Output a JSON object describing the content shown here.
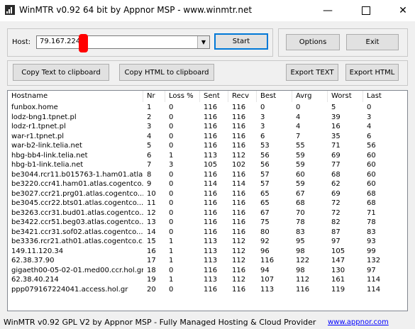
{
  "window": {
    "title": "WinMTR v0.92 64 bit by Appnor MSP - www.winmtr.net"
  },
  "host": {
    "label": "Host:",
    "value": "79.167.224."
  },
  "buttons": {
    "start": "Start",
    "options": "Options",
    "exit": "Exit",
    "copy_text": "Copy Text to clipboard",
    "copy_html": "Copy HTML to clipboard",
    "export_text": "Export TEXT",
    "export_html": "Export HTML"
  },
  "table": {
    "columns": [
      "Hostname",
      "Nr",
      "Loss %",
      "Sent",
      "Recv",
      "Best",
      "Avrg",
      "Worst",
      "Last"
    ],
    "rows": [
      [
        "funbox.home",
        "1",
        "0",
        "116",
        "116",
        "0",
        "0",
        "5",
        "0"
      ],
      [
        "lodz-bng1.tpnet.pl",
        "2",
        "0",
        "116",
        "116",
        "3",
        "4",
        "39",
        "3"
      ],
      [
        "lodz-r1.tpnet.pl",
        "3",
        "0",
        "116",
        "116",
        "3",
        "4",
        "16",
        "4"
      ],
      [
        "war-r1.tpnet.pl",
        "4",
        "0",
        "116",
        "116",
        "6",
        "7",
        "35",
        "6"
      ],
      [
        "war-b2-link.telia.net",
        "5",
        "0",
        "116",
        "116",
        "53",
        "55",
        "71",
        "56"
      ],
      [
        "hbg-bb4-link.telia.net",
        "6",
        "1",
        "113",
        "112",
        "56",
        "59",
        "69",
        "60"
      ],
      [
        "hbg-b1-link.telia.net",
        "7",
        "3",
        "105",
        "102",
        "56",
        "59",
        "77",
        "60"
      ],
      [
        "be3044.rcr11.b015763-1.ham01.atla...",
        "8",
        "0",
        "116",
        "116",
        "57",
        "60",
        "68",
        "60"
      ],
      [
        "be3220.ccr41.ham01.atlas.cogentco....",
        "9",
        "0",
        "114",
        "114",
        "57",
        "59",
        "62",
        "60"
      ],
      [
        "be3027.ccr21.prg01.atlas.cogentco....",
        "10",
        "0",
        "116",
        "116",
        "65",
        "67",
        "69",
        "68"
      ],
      [
        "be3045.ccr22.bts01.atlas.cogentco....",
        "11",
        "0",
        "116",
        "116",
        "65",
        "68",
        "72",
        "68"
      ],
      [
        "be3263.ccr31.bud01.atlas.cogentco....",
        "12",
        "0",
        "116",
        "116",
        "67",
        "70",
        "72",
        "71"
      ],
      [
        "be3422.ccr51.beg03.atlas.cogentco....",
        "13",
        "0",
        "116",
        "116",
        "75",
        "78",
        "82",
        "78"
      ],
      [
        "be3421.ccr31.sof02.atlas.cogentco....",
        "14",
        "0",
        "116",
        "116",
        "80",
        "83",
        "87",
        "83"
      ],
      [
        "be3336.rcr21.ath01.atlas.cogentco.c...",
        "15",
        "1",
        "113",
        "112",
        "92",
        "95",
        "97",
        "93"
      ],
      [
        "149.11.120.34",
        "16",
        "1",
        "113",
        "112",
        "96",
        "98",
        "105",
        "99"
      ],
      [
        "62.38.37.90",
        "17",
        "1",
        "113",
        "112",
        "116",
        "122",
        "147",
        "132"
      ],
      [
        "gigaeth00-05-02-01.med00.ccr.hol.gr",
        "18",
        "0",
        "116",
        "116",
        "94",
        "98",
        "130",
        "97"
      ],
      [
        "62.38.40.214",
        "19",
        "1",
        "113",
        "112",
        "107",
        "112",
        "161",
        "114"
      ],
      [
        "ppp079167224041.access.hol.gr",
        "20",
        "0",
        "116",
        "116",
        "113",
        "116",
        "119",
        "114"
      ]
    ]
  },
  "status": {
    "text": "WinMTR v0.92 GPL V2 by Appnor MSP - Fully Managed Hosting & Cloud Provider",
    "link": "www.appnor.com"
  }
}
